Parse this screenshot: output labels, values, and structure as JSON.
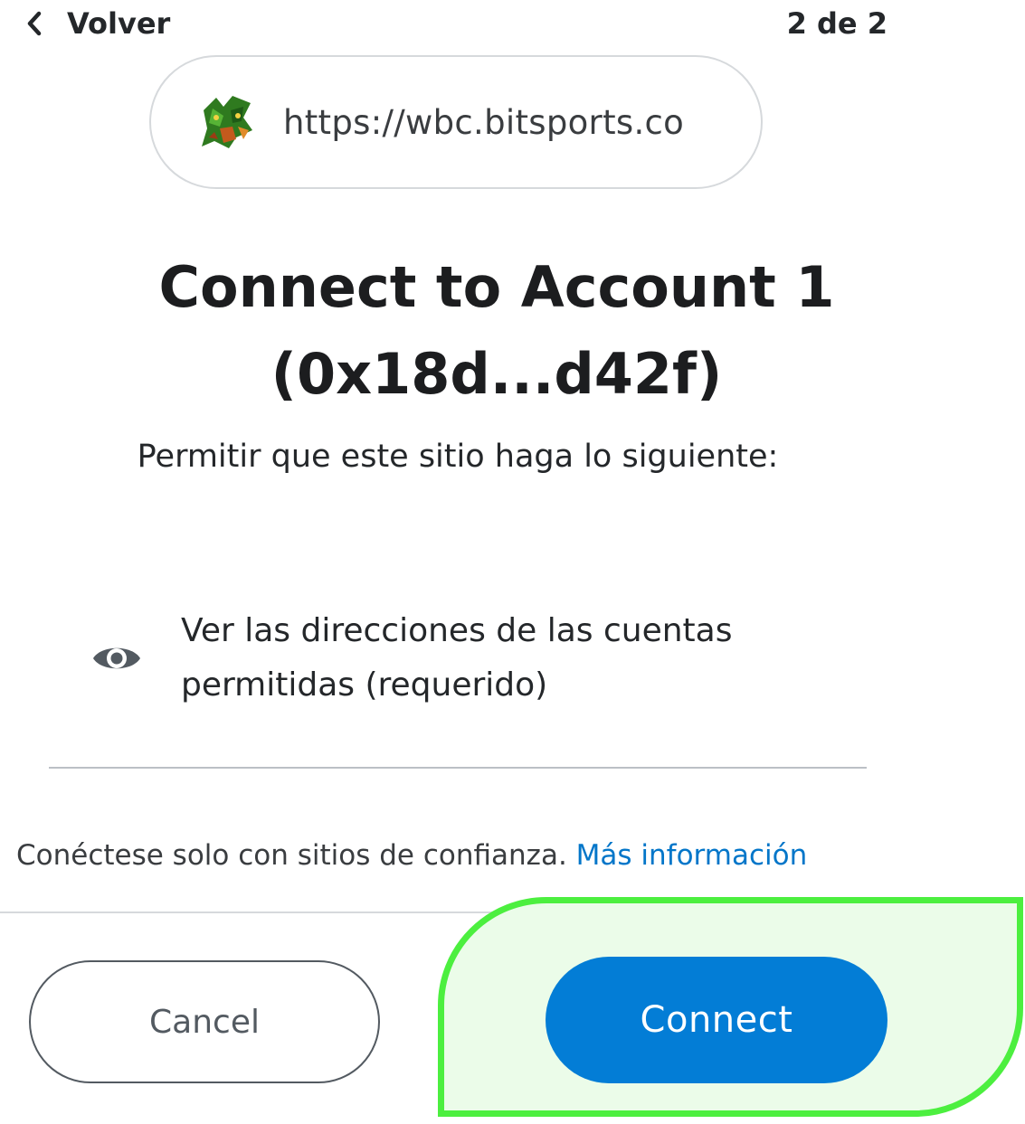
{
  "nav": {
    "back_label": "Volver",
    "step": "2 de 2"
  },
  "origin": {
    "url": "https://wbc.bitsports.co",
    "icon": "site-favicon-icon"
  },
  "title": {
    "line1": "Connect to Account 1",
    "line2": "(0x18d...d42f)"
  },
  "subtitle": "Permitir que este sitio haga lo siguiente:",
  "permission": {
    "icon": "eye-icon",
    "text": "Ver las direcciones de las cuentas permitidas (requerido)"
  },
  "trust": {
    "text": "Conéctese solo con sitios de confianza.",
    "link": "Más información"
  },
  "buttons": {
    "cancel": "Cancel",
    "connect": "Connect"
  },
  "colors": {
    "primary": "#037dd6",
    "link": "#0376c9",
    "highlight_border": "#4cef3f",
    "highlight_fill": "#ebfce9"
  }
}
